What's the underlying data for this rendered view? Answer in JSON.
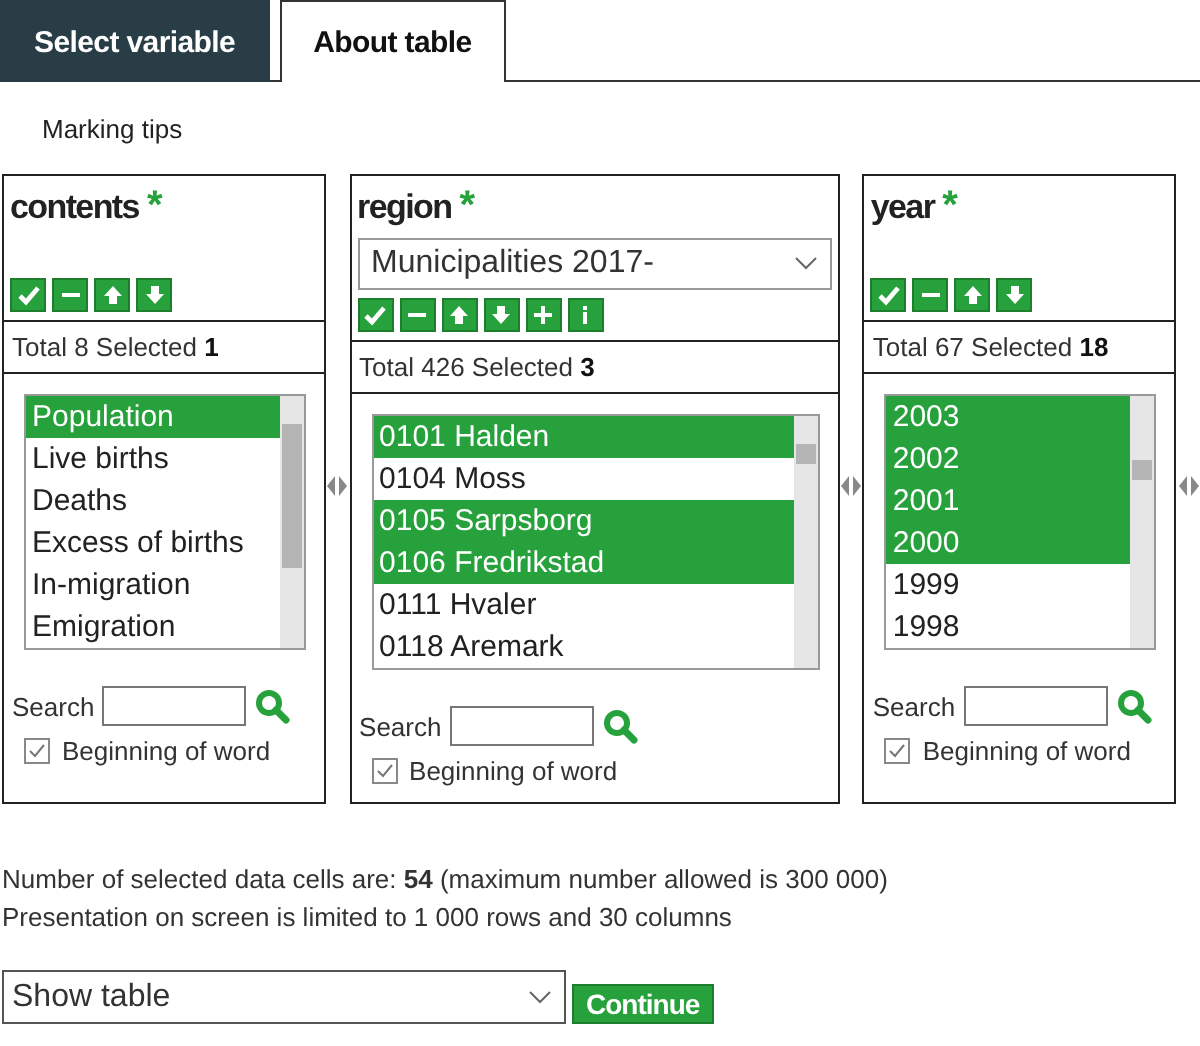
{
  "tabs": [
    {
      "label": "Select variable",
      "selected": true
    },
    {
      "label": "About table",
      "selected": false
    }
  ],
  "marking_tips": "Marking tips",
  "variables": [
    {
      "title": "contents",
      "required_mark": "*",
      "buttons": [
        {
          "kind": "check"
        },
        {
          "kind": "minus"
        },
        {
          "kind": "up"
        },
        {
          "kind": "down"
        }
      ],
      "total_label": "Total 8 Selected",
      "selected_count": "1",
      "items": [
        {
          "label": "Population",
          "selected": true
        },
        {
          "label": "Live births",
          "selected": false
        },
        {
          "label": "Deaths",
          "selected": false
        },
        {
          "label": "Excess of births",
          "selected": false
        },
        {
          "label": "In-migration",
          "selected": false
        },
        {
          "label": "Emigration",
          "selected": false
        }
      ],
      "search_label": "Search",
      "beginning_of_word": {
        "label": "Beginning of word",
        "checked": true
      }
    },
    {
      "title": "region",
      "required_mark": "*",
      "grouping": "Municipalities 2017-",
      "buttons": [
        {
          "kind": "check"
        },
        {
          "kind": "minus"
        },
        {
          "kind": "up"
        },
        {
          "kind": "down"
        },
        {
          "kind": "plus"
        },
        {
          "kind": "info"
        }
      ],
      "total_label": "Total 426 Selected",
      "selected_count": "3",
      "items": [
        {
          "label": "0101 Halden",
          "selected": true
        },
        {
          "label": "0104 Moss",
          "selected": false
        },
        {
          "label": "0105 Sarpsborg",
          "selected": true
        },
        {
          "label": "0106 Fredrikstad",
          "selected": true
        },
        {
          "label": "0111 Hvaler",
          "selected": false
        },
        {
          "label": "0118 Aremark",
          "selected": false
        }
      ],
      "search_label": "Search",
      "beginning_of_word": {
        "label": "Beginning of word",
        "checked": true
      }
    },
    {
      "title": "year",
      "required_mark": "*",
      "buttons": [
        {
          "kind": "check"
        },
        {
          "kind": "minus"
        },
        {
          "kind": "up"
        },
        {
          "kind": "down"
        }
      ],
      "total_label": "Total 67 Selected",
      "selected_count": "18",
      "items": [
        {
          "label": "2003",
          "selected": true
        },
        {
          "label": "2002",
          "selected": true
        },
        {
          "label": "2001",
          "selected": true
        },
        {
          "label": "2000",
          "selected": true
        },
        {
          "label": "1999",
          "selected": false
        },
        {
          "label": "1998",
          "selected": false
        }
      ],
      "search_label": "Search",
      "beginning_of_word": {
        "label": "Beginning of word",
        "checked": true
      }
    }
  ],
  "summary": [
    "Number of selected data cells are: **54** (maximum number allowed is 300 000)",
    "Presentation on screen is limited to 1 000 rows and 30 columns"
  ],
  "presentation": "Show table",
  "continue_button": "Continue"
}
